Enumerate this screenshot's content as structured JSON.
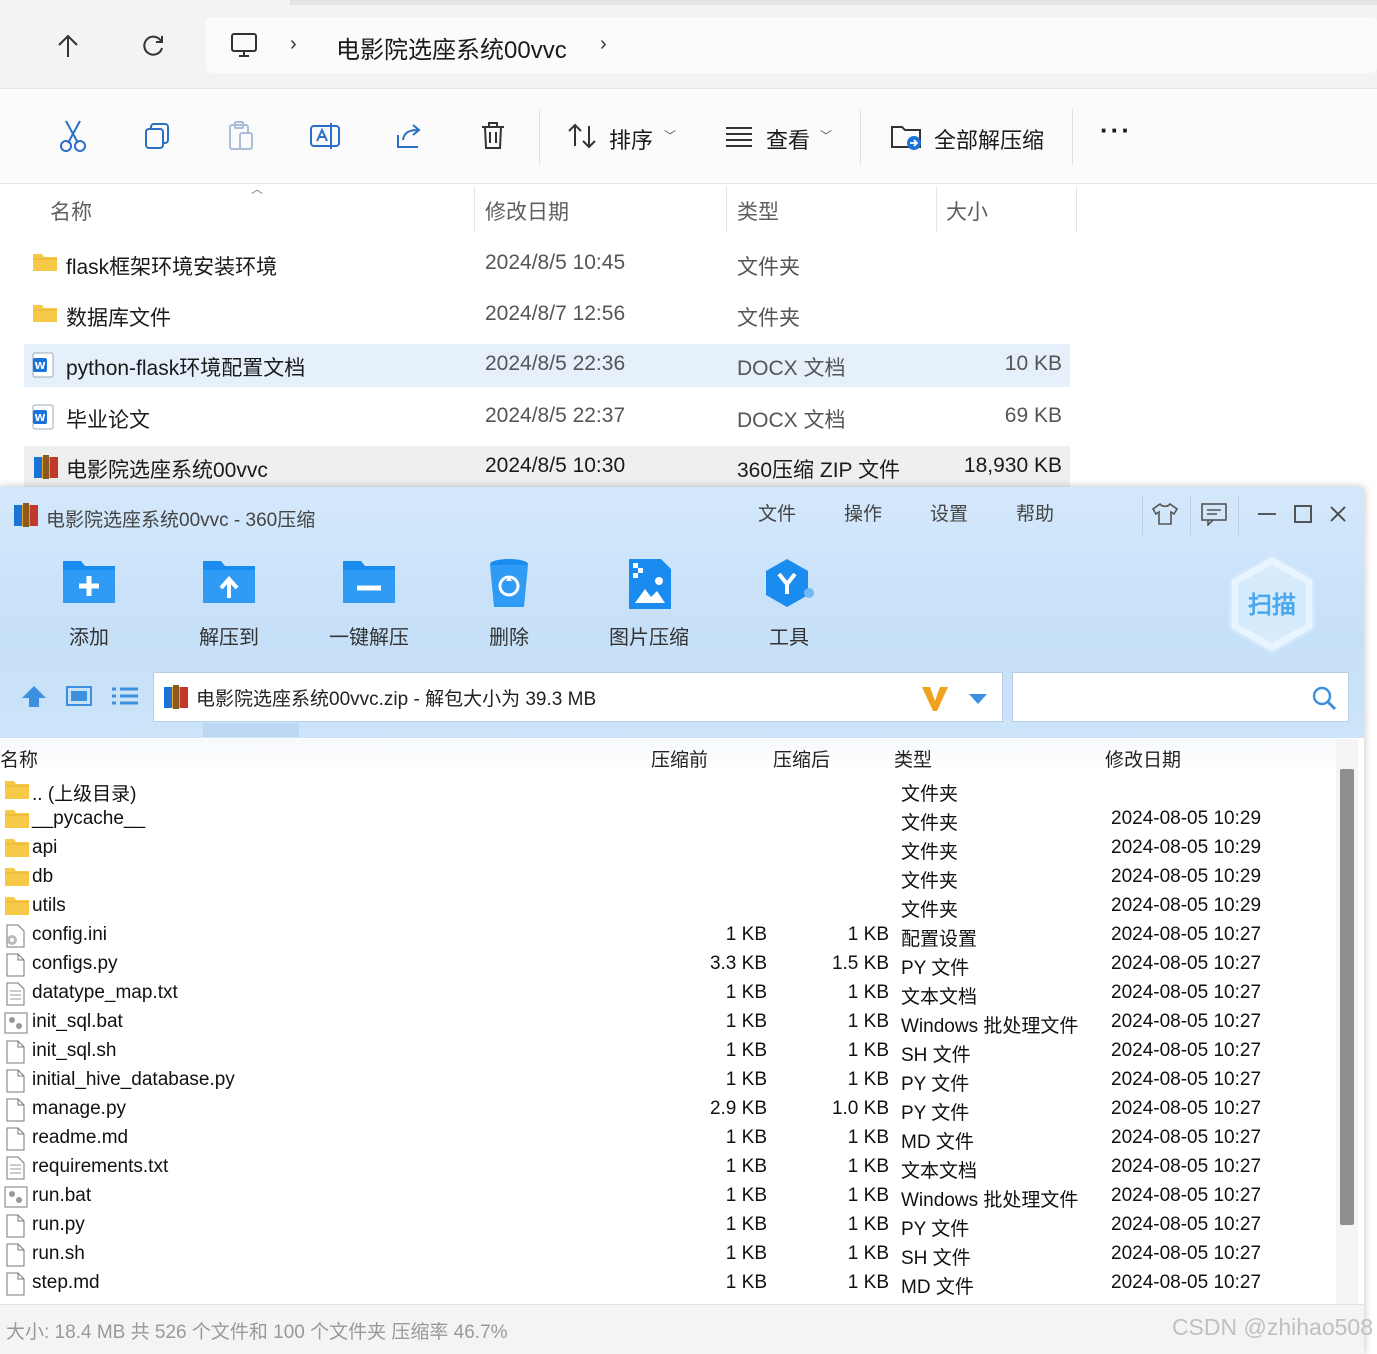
{
  "explorer": {
    "breadcrumb": "电影院选座系统00vvc",
    "toolbar": {
      "sort_label": "排序",
      "view_label": "查看",
      "extract_all_label": "全部解压缩"
    },
    "columns": {
      "name": "名称",
      "date": "修改日期",
      "type": "类型",
      "size": "大小"
    },
    "rows": [
      {
        "name": "flask框架环境安装环境",
        "date": "2024/8/5 10:45",
        "type": "文件夹",
        "size": "",
        "icon": "folder-icon"
      },
      {
        "name": "数据库文件",
        "date": "2024/8/7 12:56",
        "type": "文件夹",
        "size": "",
        "icon": "folder-icon"
      },
      {
        "name": "python-flask环境配置文档",
        "date": "2024/8/5 22:36",
        "type": "DOCX 文档",
        "size": "10 KB",
        "icon": "word-doc-icon"
      },
      {
        "name": "毕业论文",
        "date": "2024/8/5 22:37",
        "type": "DOCX 文档",
        "size": "69 KB",
        "icon": "word-doc-icon"
      },
      {
        "name": "电影院选座系统00vvc",
        "date": "2024/8/5 10:30",
        "type": "360压缩 ZIP 文件",
        "size": "18,930 KB",
        "icon": "zip-archive-icon"
      }
    ]
  },
  "zip360": {
    "title": "电影院选座系统00vvc - 360压缩",
    "menu": [
      "文件",
      "操作",
      "设置",
      "帮助"
    ],
    "tools": [
      "添加",
      "解压到",
      "一键解压",
      "删除",
      "图片压缩",
      "工具"
    ],
    "scan_label": "扫描",
    "path_text": "电影院选座系统00vvc.zip - 解包大小为 39.3 MB",
    "search_value": "",
    "columns": {
      "name": "名称",
      "before": "压缩前",
      "after": "压缩后",
      "type": "类型",
      "date": "修改日期"
    },
    "rows": [
      {
        "name": ".. (上级目录)",
        "before": "",
        "after": "",
        "type": "文件夹",
        "date": "",
        "icon": "folder-icon"
      },
      {
        "name": "__pycache__",
        "before": "",
        "after": "",
        "type": "文件夹",
        "date": "2024-08-05 10:29",
        "icon": "folder-icon"
      },
      {
        "name": "api",
        "before": "",
        "after": "",
        "type": "文件夹",
        "date": "2024-08-05 10:29",
        "icon": "folder-icon"
      },
      {
        "name": "db",
        "before": "",
        "after": "",
        "type": "文件夹",
        "date": "2024-08-05 10:29",
        "icon": "folder-icon"
      },
      {
        "name": "utils",
        "before": "",
        "after": "",
        "type": "文件夹",
        "date": "2024-08-05 10:29",
        "icon": "folder-icon"
      },
      {
        "name": "config.ini",
        "before": "1 KB",
        "after": "1 KB",
        "type": "配置设置",
        "date": "2024-08-05 10:27",
        "icon": "settings-file-icon"
      },
      {
        "name": "configs.py",
        "before": "3.3 KB",
        "after": "1.5 KB",
        "type": "PY 文件",
        "date": "2024-08-05 10:27",
        "icon": "file-icon"
      },
      {
        "name": "datatype_map.txt",
        "before": "1 KB",
        "after": "1 KB",
        "type": "文本文档",
        "date": "2024-08-05 10:27",
        "icon": "text-file-icon"
      },
      {
        "name": "init_sql.bat",
        "before": "1 KB",
        "after": "1 KB",
        "type": "Windows 批处理文件",
        "date": "2024-08-05 10:27",
        "icon": "batch-file-icon"
      },
      {
        "name": "init_sql.sh",
        "before": "1 KB",
        "after": "1 KB",
        "type": "SH 文件",
        "date": "2024-08-05 10:27",
        "icon": "file-icon"
      },
      {
        "name": "initial_hive_database.py",
        "before": "1 KB",
        "after": "1 KB",
        "type": "PY 文件",
        "date": "2024-08-05 10:27",
        "icon": "file-icon"
      },
      {
        "name": "manage.py",
        "before": "2.9 KB",
        "after": "1.0 KB",
        "type": "PY 文件",
        "date": "2024-08-05 10:27",
        "icon": "file-icon"
      },
      {
        "name": "readme.md",
        "before": "1 KB",
        "after": "1 KB",
        "type": "MD 文件",
        "date": "2024-08-05 10:27",
        "icon": "file-icon"
      },
      {
        "name": "requirements.txt",
        "before": "1 KB",
        "after": "1 KB",
        "type": "文本文档",
        "date": "2024-08-05 10:27",
        "icon": "text-file-icon"
      },
      {
        "name": "run.bat",
        "before": "1 KB",
        "after": "1 KB",
        "type": "Windows 批处理文件",
        "date": "2024-08-05 10:27",
        "icon": "batch-file-icon"
      },
      {
        "name": "run.py",
        "before": "1 KB",
        "after": "1 KB",
        "type": "PY 文件",
        "date": "2024-08-05 10:27",
        "icon": "file-icon"
      },
      {
        "name": "run.sh",
        "before": "1 KB",
        "after": "1 KB",
        "type": "SH 文件",
        "date": "2024-08-05 10:27",
        "icon": "file-icon"
      },
      {
        "name": "step.md",
        "before": "1 KB",
        "after": "1 KB",
        "type": "MD 文件",
        "date": "2024-08-05 10:27",
        "icon": "file-icon"
      }
    ],
    "status": "大小: 18.4 MB 共 526 个文件和 100 个文件夹 压缩率 46.7%"
  },
  "watermark": "CSDN @zhihao508",
  "colors": {
    "accent_blue": "#1a8cf0",
    "zip_orange": "#f0a21d",
    "folder_yellow": "#f7c948",
    "selected_row": "#e5f0fb"
  }
}
